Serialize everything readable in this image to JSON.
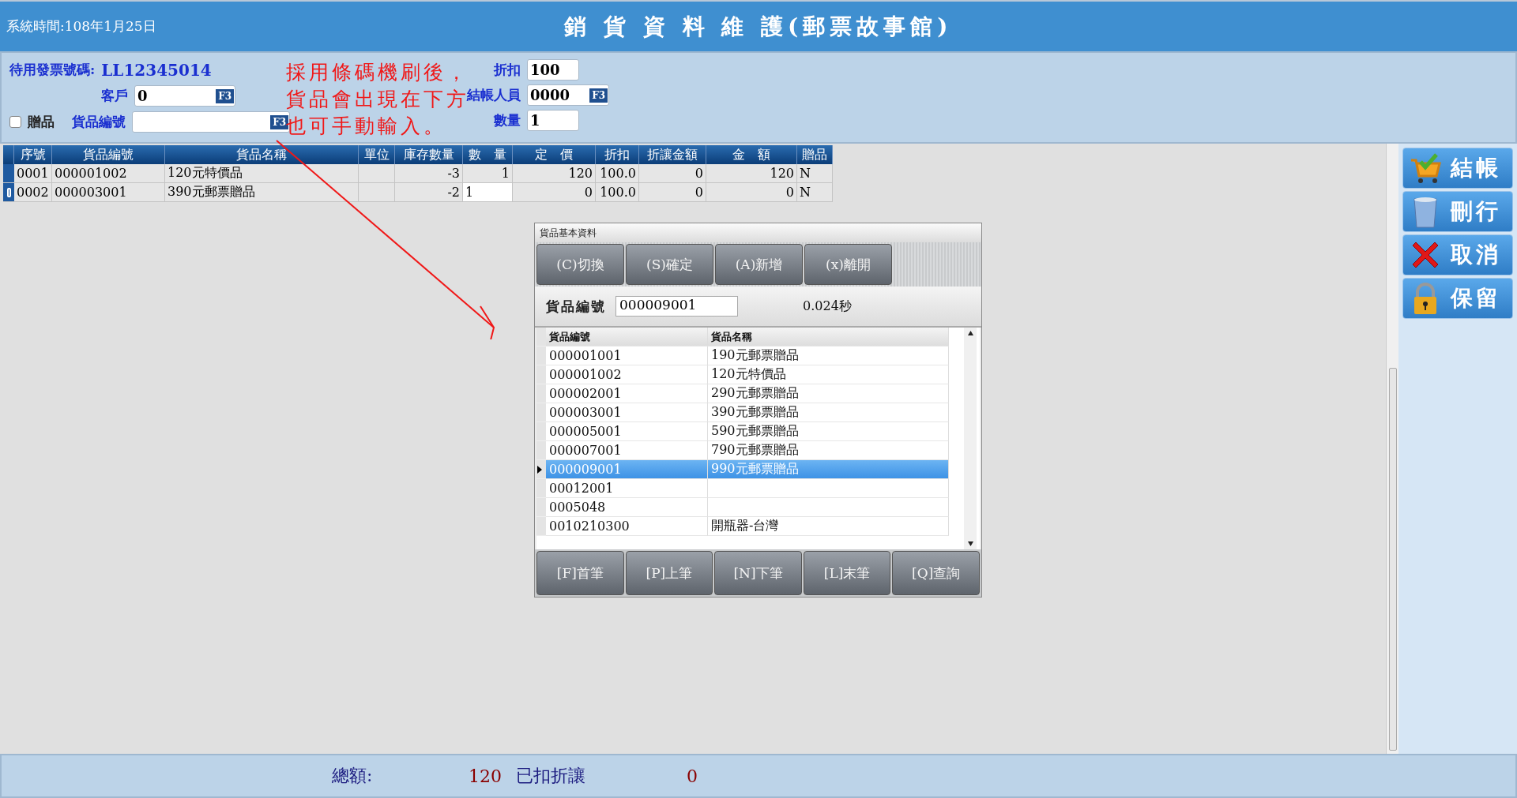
{
  "header": {
    "system_time": "系統時間:108年1月25日",
    "title": "銷 貨 資 料 維 護(郵票故事館)"
  },
  "form": {
    "invoice_label": "待用發票號碼:",
    "invoice_number": "LL12345014",
    "customer": {
      "label": "客戶",
      "value": "0",
      "lookup_key": "F3"
    },
    "gift": {
      "label": "贈品",
      "checked": false
    },
    "product_code": {
      "label": "貨品編號",
      "lookup_key": "F3"
    },
    "discount": {
      "label": "折扣",
      "value": "100"
    },
    "cashier": {
      "label": "結帳人員",
      "value": "0000",
      "lookup_key": "F3"
    },
    "quantity": {
      "label": "數量",
      "value": "1"
    }
  },
  "annotation": {
    "lines": [
      "採用條碼機刷後，",
      "貨品會出現在下方",
      "也可手動輸入。"
    ]
  },
  "sales_table": {
    "columns": [
      "序號",
      "貨品編號",
      "貨品名稱",
      "單位",
      "庫存數量",
      "數　量",
      "定　價",
      "折扣",
      "折讓金額",
      "金　額",
      "贈品"
    ],
    "rows": [
      {
        "editing": false,
        "cells": [
          "0001",
          "000001002",
          "120元特價品",
          "",
          "-3",
          "1",
          "120",
          "100.0",
          "0",
          "120",
          "N"
        ]
      },
      {
        "editing": true,
        "cells": [
          "0002",
          "000003001",
          "390元郵票贈品",
          "",
          "-2",
          "1",
          "0",
          "100.0",
          "0",
          "0",
          "N"
        ]
      }
    ]
  },
  "actions": [
    {
      "kind": "checkout",
      "label": "結帳"
    },
    {
      "kind": "delete",
      "label": "刪行"
    },
    {
      "kind": "cancel",
      "label": "取消"
    },
    {
      "kind": "hold",
      "label": "保留"
    }
  ],
  "dialog": {
    "title": "貨品基本資料",
    "toolbar": [
      "(C)切換",
      "(S)確定",
      "(A)新增",
      "(x)離開"
    ],
    "search": {
      "label": "貨品編號",
      "value": "000009001",
      "elapsed": "0.024秒"
    },
    "columns": [
      "貨品編號",
      "貨品名稱"
    ],
    "rows": [
      {
        "code": "000001001",
        "name": "190元郵票贈品",
        "selected": false
      },
      {
        "code": "000001002",
        "name": "120元特價品",
        "selected": false
      },
      {
        "code": "000002001",
        "name": "290元郵票贈品",
        "selected": false
      },
      {
        "code": "000003001",
        "name": "390元郵票贈品",
        "selected": false
      },
      {
        "code": "000005001",
        "name": "590元郵票贈品",
        "selected": false
      },
      {
        "code": "000007001",
        "name": "790元郵票贈品",
        "selected": false
      },
      {
        "code": "000009001",
        "name": "990元郵票贈品",
        "selected": true
      },
      {
        "code": "00012001",
        "selected": false
      },
      {
        "code": "0005048",
        "selected": false
      },
      {
        "code": "0010210300",
        "name": "開瓶器-台灣",
        "selected": false
      }
    ],
    "nav": [
      "[F]首筆",
      "[P]上筆",
      "[N]下筆",
      "[L]末筆",
      "[Q]查詢"
    ]
  },
  "footer": {
    "total_label": "總額:",
    "total": "120",
    "discount_label": "已扣折讓",
    "discount": "0"
  }
}
